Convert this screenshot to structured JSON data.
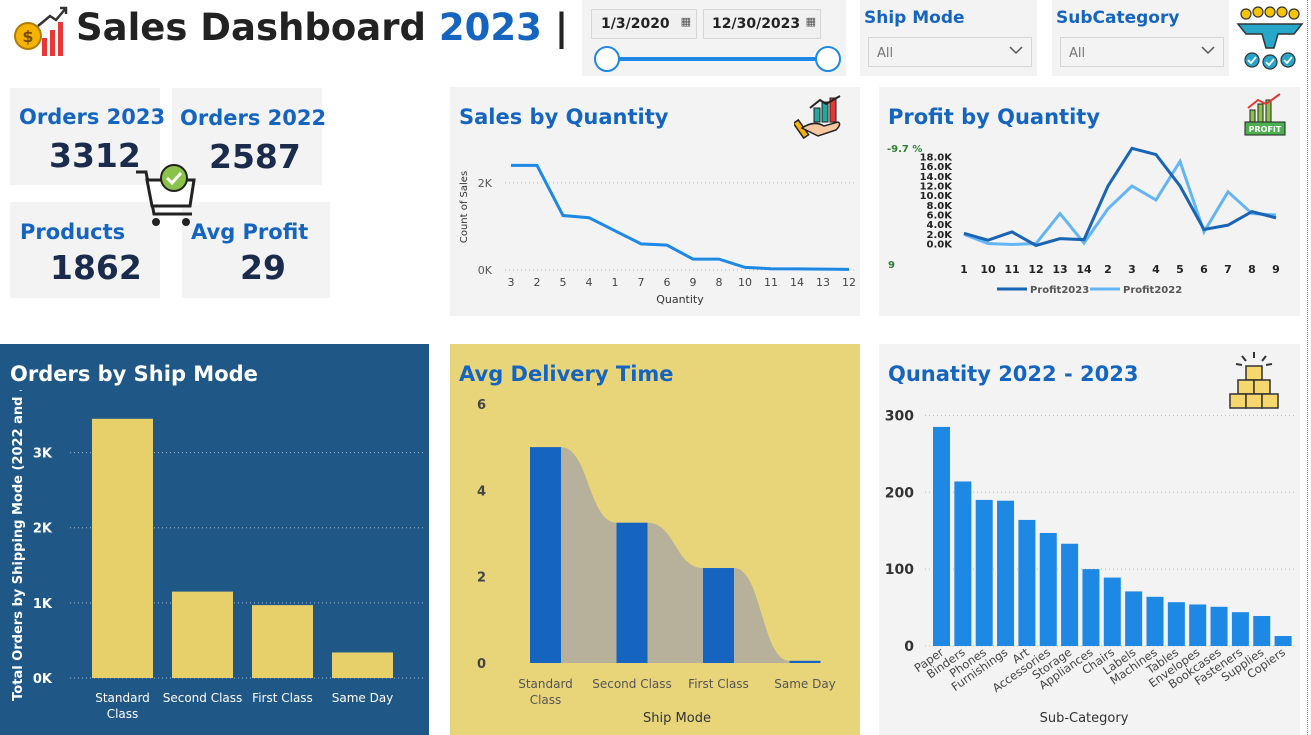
{
  "header": {
    "title_text": "Sales Dashboard",
    "title_year": "2023",
    "title_bar": "|"
  },
  "date_range": {
    "start": "1/3/2020",
    "end": "12/30/2023",
    "slider_fill_fraction": 1.0
  },
  "slicers": {
    "ship_mode": {
      "label": "Ship Mode",
      "value": "All"
    },
    "subcategory": {
      "label": "SubCategory",
      "value": "All"
    }
  },
  "kpis": {
    "orders_2023": {
      "label": "Orders 2023",
      "value": "3312"
    },
    "orders_2022": {
      "label": "Orders 2022",
      "value": "2587"
    },
    "products": {
      "label": "Products",
      "value": "1862"
    },
    "avg_profit": {
      "label": "Avg Profit",
      "value": "29"
    }
  },
  "colors": {
    "accent_blue": "#1565c0",
    "line_blue": "#1e88e5",
    "dark_navy": "#1f5887",
    "gold": "#e7cf6a",
    "panel_gray": "#f3f3f3",
    "profit2023": "#1a64b4",
    "profit2022": "#64b5f6"
  },
  "icons": {
    "header": "sales-growth-icon",
    "filter": "funnel-filter-icon",
    "cart": "shopping-cart-check-icon",
    "sales_qty": "hand-growth-icon",
    "profit_qty": "profit-chart-icon",
    "quantity": "boxes-icon",
    "calendar": "calendar-icon",
    "dropdown": "chevron-down-icon"
  },
  "chart_data": [
    {
      "id": "sales_by_quantity",
      "type": "line",
      "title": "Sales by Quantity",
      "xlabel": "Quantity",
      "ylabel": "Count of Sales",
      "x": [
        "3",
        "2",
        "5",
        "4",
        "1",
        "7",
        "6",
        "9",
        "8",
        "10",
        "11",
        "14",
        "13",
        "12"
      ],
      "values": [
        2400,
        2400,
        1250,
        1200,
        900,
        600,
        570,
        250,
        250,
        60,
        30,
        25,
        20,
        15
      ],
      "ylim": [
        0,
        2800
      ],
      "yticks": [
        {
          "v": 0,
          "label": "0K"
        },
        {
          "v": 2000,
          "label": "2K"
        }
      ],
      "grid": true
    },
    {
      "id": "profit_by_quantity",
      "type": "line",
      "title": "Profit by Quantity",
      "side_labels": [
        "-9.7 %",
        "9"
      ],
      "x": [
        "1",
        "10",
        "11",
        "12",
        "13",
        "14",
        "2",
        "3",
        "4",
        "5",
        "6",
        "7",
        "8",
        "9"
      ],
      "series": [
        {
          "name": "Profit2023",
          "values": [
            2200,
            800,
            2500,
            -300,
            1100,
            900,
            12000,
            19800,
            18500,
            12000,
            3000,
            3900,
            6700,
            5400
          ]
        },
        {
          "name": "Profit2022",
          "values": [
            2000,
            100,
            -100,
            100,
            6300,
            200,
            7300,
            12000,
            9100,
            17100,
            2500,
            10800,
            6300,
            6000
          ]
        }
      ],
      "ylim": [
        0,
        18000
      ],
      "yticks": [
        "0.0K",
        "2.0K",
        "4.0K",
        "6.0K",
        "8.0K",
        "10.0K",
        "12.0K",
        "14.0K",
        "16.0K",
        "18.0K"
      ],
      "legend": "bottom"
    },
    {
      "id": "orders_by_ship_mode",
      "type": "bar",
      "title": "Orders by Ship Mode",
      "ylabel": "Total Orders by Shipping Mode (2022 and ...",
      "categories": [
        "Standard Class",
        "Second Class",
        "First Class",
        "Same Day"
      ],
      "values": [
        3450,
        1150,
        970,
        340
      ],
      "ylim": [
        0,
        3700
      ],
      "yticks": [
        {
          "v": 0,
          "label": "0K"
        },
        {
          "v": 1000,
          "label": "1K"
        },
        {
          "v": 2000,
          "label": "2K"
        },
        {
          "v": 3000,
          "label": "3K"
        }
      ],
      "grid": true
    },
    {
      "id": "avg_delivery_time",
      "type": "bar",
      "title": "Avg Delivery Time",
      "xlabel": "Ship Mode",
      "categories": [
        "Standard Class",
        "Second Class",
        "First Class",
        "Same Day"
      ],
      "values": [
        5.0,
        3.25,
        2.2,
        0.05
      ],
      "ylim": [
        0,
        6
      ],
      "yticks": [
        {
          "v": 0,
          "label": "0"
        },
        {
          "v": 2,
          "label": "2"
        },
        {
          "v": 4,
          "label": "4"
        },
        {
          "v": 6,
          "label": "6"
        }
      ]
    },
    {
      "id": "quantity_2022_2023",
      "type": "bar",
      "title": "Qunatity 2022 - 2023",
      "xlabel": "Sub-Category",
      "categories": [
        "Paper",
        "Binders",
        "Phones",
        "Furnishings",
        "Art",
        "Accessories",
        "Storage",
        "Appliances",
        "Chairs",
        "Labels",
        "Machines",
        "Tables",
        "Envelopes",
        "Bookcases",
        "Fasteners",
        "Supplies",
        "Copiers"
      ],
      "values": [
        285,
        214,
        190,
        189,
        164,
        147,
        133,
        100,
        89,
        71,
        64,
        57,
        54,
        51,
        44,
        39,
        13
      ],
      "ylim": [
        0,
        320
      ],
      "yticks": [
        {
          "v": 0,
          "label": "0"
        },
        {
          "v": 100,
          "label": "100"
        },
        {
          "v": 200,
          "label": "200"
        },
        {
          "v": 300,
          "label": "300"
        }
      ],
      "grid": true
    }
  ]
}
